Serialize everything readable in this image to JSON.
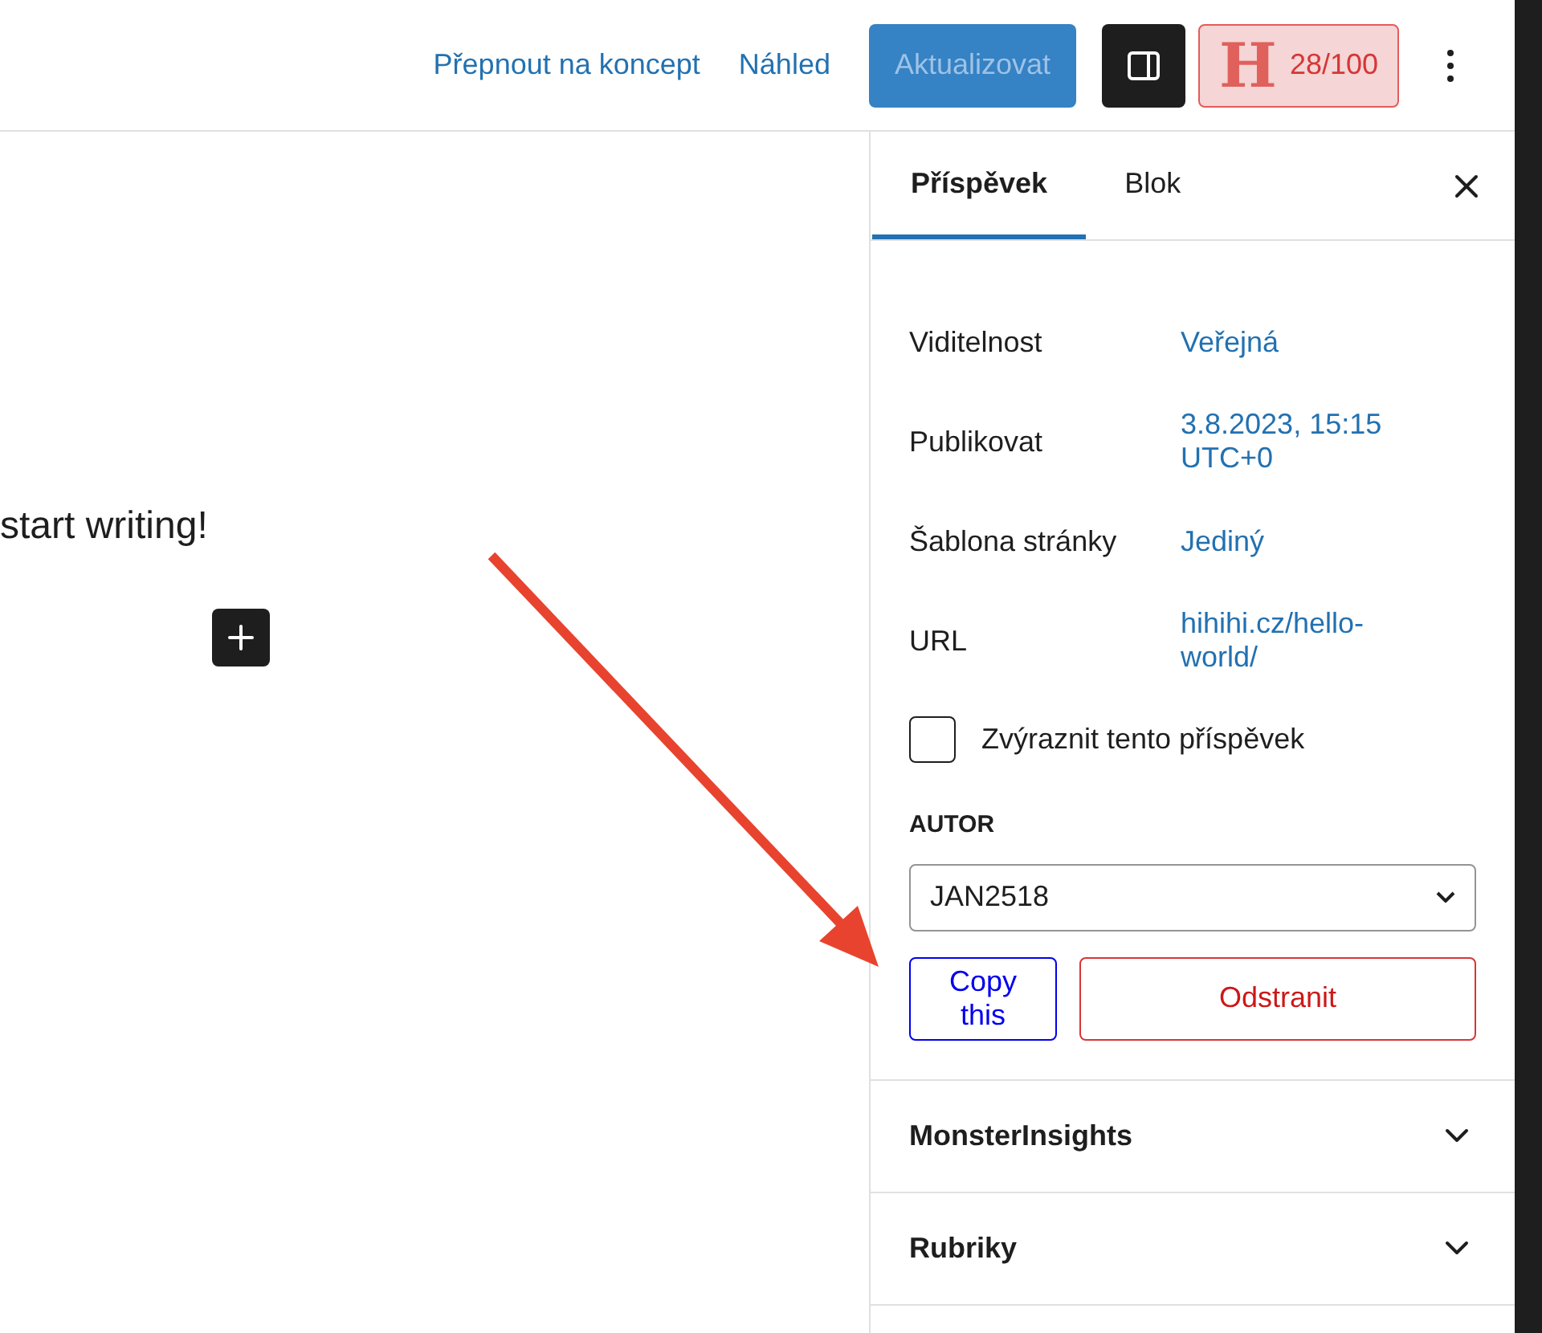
{
  "toolbar": {
    "links": [
      "Přepnout na koncept",
      "Náhled"
    ],
    "update_button": {
      "label": "Aktualizovat",
      "disabled": true
    },
    "settings_toggle": {
      "on": true
    },
    "seo_score": {
      "letter": "H",
      "score": "28/100"
    }
  },
  "editor": {
    "text": "start writing!"
  },
  "sidebar": {
    "tabs": [
      {
        "label": "Příspěvek",
        "selected": true
      },
      {
        "label": "Blok",
        "selected": false
      }
    ],
    "fields": [
      {
        "label": "Viditelnost",
        "value": "Veřejná"
      },
      {
        "label": "Publikovat",
        "value": "3.8.2023, 15:15 UTC+0"
      },
      {
        "label": "Šablona stránky",
        "value": "Jediný"
      },
      {
        "label": "URL",
        "value": "hihihi.cz/hello-world/"
      }
    ],
    "sticky": {
      "label": "Zvýraznit tento příspěvek",
      "checked": false
    },
    "author": {
      "label": "AUTOR",
      "value": "JAN2518"
    },
    "copy_button": "Copy this",
    "delete_button": "Odstranit",
    "panels": [
      {
        "title": "MonsterInsights",
        "expanded": false
      },
      {
        "title": "Rubriky",
        "expanded": false
      }
    ]
  }
}
